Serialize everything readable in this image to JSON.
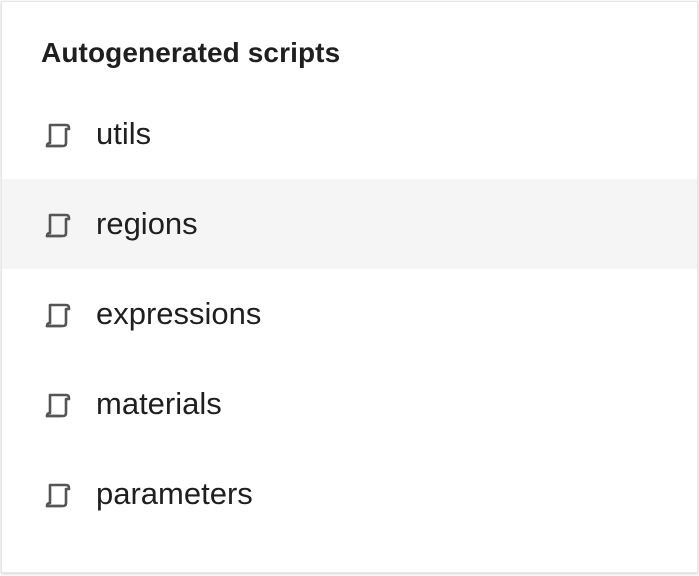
{
  "panel": {
    "title": "Autogenerated scripts",
    "hover_index": 1,
    "items": [
      {
        "label": "utils",
        "icon": "script-scroll-icon"
      },
      {
        "label": "regions",
        "icon": "script-scroll-icon"
      },
      {
        "label": "expressions",
        "icon": "script-scroll-icon"
      },
      {
        "label": "materials",
        "icon": "script-scroll-icon"
      },
      {
        "label": "parameters",
        "icon": "script-scroll-icon"
      }
    ]
  },
  "colors": {
    "text": "#1f1f1f",
    "icon": "#555555",
    "hover_background": "#f5f5f5",
    "panel_background": "#ffffff"
  }
}
